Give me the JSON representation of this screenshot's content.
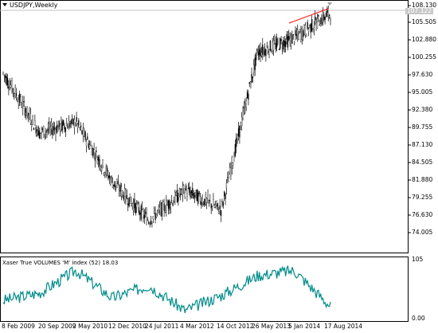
{
  "window": {
    "title": "USDJPY,Weekly",
    "indicator_title": "Xaser True VOLUMES 'M' index (52) 18.03"
  },
  "price_axis": {
    "labels": [
      "108.130",
      "105.505",
      "102.880",
      "100.255",
      "97.630",
      "95.005",
      "92.380",
      "89.755",
      "87.130",
      "84.505",
      "81.880",
      "79.255",
      "76.630",
      "74.005"
    ],
    "current_price": "107.122"
  },
  "indicator_axis": {
    "labels": [
      "105",
      "0.00"
    ]
  },
  "time_axis": {
    "labels": [
      "8 Feb 2009",
      "20 Sep 2009",
      "2 May 2010",
      "12 Dec 2010",
      "24 Jul 2011",
      "4 Mar 2012",
      "14 Oct 2012",
      "26 May 2013",
      "5 Jan 2014",
      "17 Aug 2014"
    ]
  },
  "colors": {
    "candles": "#000000",
    "trendline": "#ff0000",
    "indicator": "#008b8b",
    "grid": "#c0c0c0"
  },
  "chart_data": [
    {
      "type": "line",
      "title": "USDJPY,Weekly",
      "ylim": [
        73.0,
        108.5
      ],
      "x": [
        "8 Feb 2009",
        "20 Sep 2009",
        "2 May 2010",
        "12 Dec 2010",
        "24 Jul 2011",
        "4 Mar 2012",
        "14 Oct 2012",
        "26 May 2013",
        "5 Jan 2014",
        "17 Aug 2014"
      ],
      "series": [
        {
          "name": "USDJPY",
          "values": [
            98.5,
            90.0,
            91.5,
            83.0,
            77.5,
            81.8,
            79.0,
            101.5,
            103.5,
            107.1
          ]
        }
      ]
    },
    {
      "type": "line",
      "title": "Xaser True VOLUMES 'M' index (52) 18.03",
      "ylim": [
        0,
        105
      ],
      "x": [
        "8 Feb 2009",
        "20 Sep 2009",
        "2 May 2010",
        "12 Dec 2010",
        "24 Jul 2011",
        "4 Mar 2012",
        "14 Oct 2012",
        "26 May 2013",
        "5 Jan 2014",
        "17 Aug 2014"
      ],
      "series": [
        {
          "name": "Xaser True VOLUMES 'M' index",
          "values": [
            30,
            45,
            90,
            35,
            60,
            10,
            40,
            80,
            90,
            18
          ]
        }
      ]
    }
  ]
}
